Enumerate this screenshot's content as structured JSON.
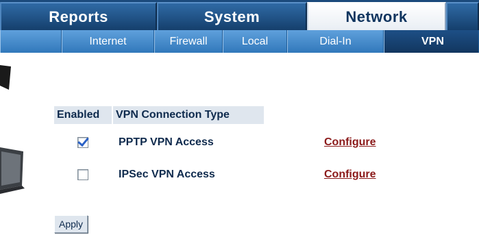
{
  "top_tabs": [
    {
      "label": "Reports"
    },
    {
      "label": "System"
    },
    {
      "label": "Network",
      "active": true
    },
    {
      "label": ""
    }
  ],
  "sub_tabs": [
    {
      "label": ""
    },
    {
      "label": "Internet"
    },
    {
      "label": "Firewall"
    },
    {
      "label": "Local"
    },
    {
      "label": "Dial-In"
    },
    {
      "label": "VPN",
      "active": true
    }
  ],
  "table": {
    "header_enabled": "Enabled",
    "header_type": "VPN Connection Type",
    "rows": [
      {
        "enabled": true,
        "type": "PPTP VPN Access",
        "action": "Configure"
      },
      {
        "enabled": false,
        "type": "IPSec VPN Access",
        "action": "Configure"
      }
    ]
  },
  "apply_label": "Apply",
  "colors": {
    "top_bar": "#1b4a7c",
    "sub_bar": "#3a80c4",
    "active_sub_tab": "#173f6e",
    "header_bg": "#dfe6ee",
    "link": "#8b1a1a"
  }
}
